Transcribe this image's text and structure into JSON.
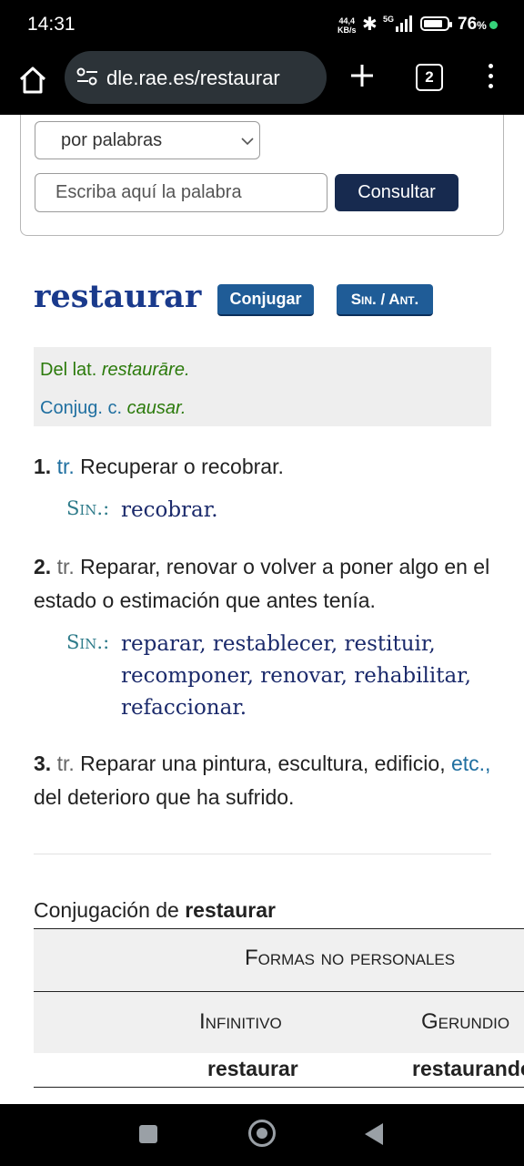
{
  "status": {
    "time": "14:31",
    "speed_value": "44,4",
    "speed_unit": "KB/s",
    "network": "5G",
    "battery_pct": "76",
    "battery_sign": "%"
  },
  "browser": {
    "url": "dle.rae.es/restaurar",
    "tab_count": "2"
  },
  "search": {
    "mode": "por palabras",
    "placeholder": "Escriba aquí la palabra",
    "button": "Consultar"
  },
  "entry": {
    "lemma": "restaurar",
    "conj_button": "Conjugar",
    "sin_button": "Sin. / Ant.",
    "etymology": {
      "prefix": "Del lat.",
      "word": "restaurāre."
    },
    "conjugation_note": {
      "prefix": "Conjug. c.",
      "word": "causar."
    },
    "senses": [
      {
        "num": "1.",
        "abbr": "tr.",
        "text": "Recuperar o recobrar.",
        "sin_label": "Sin.:",
        "synonyms": "recobrar."
      },
      {
        "num": "2.",
        "abbr": "tr.",
        "text": "Reparar, renovar o volver a poner algo en el estado o estimación que antes tenía.",
        "sin_label": "Sin.:",
        "synonyms_line1": "reparar, restablecer, restituir,",
        "synonyms_line2": "recomponer, renovar, rehabilitar,",
        "synonyms_line3": "refaccionar."
      },
      {
        "num": "3.",
        "abbr": "tr.",
        "text_a": "Reparar una pintura, escultura, edificio,",
        "etc": "etc.,",
        "text_b": "del deterioro que ha sufrido."
      }
    ]
  },
  "conjugation": {
    "title_prefix": "Conjugación de",
    "title_word": "restaurar",
    "header": "Formas no personales",
    "columns": [
      "Infinitivo",
      "Gerundio"
    ],
    "row": [
      "restaurar",
      "restaurando"
    ]
  }
}
